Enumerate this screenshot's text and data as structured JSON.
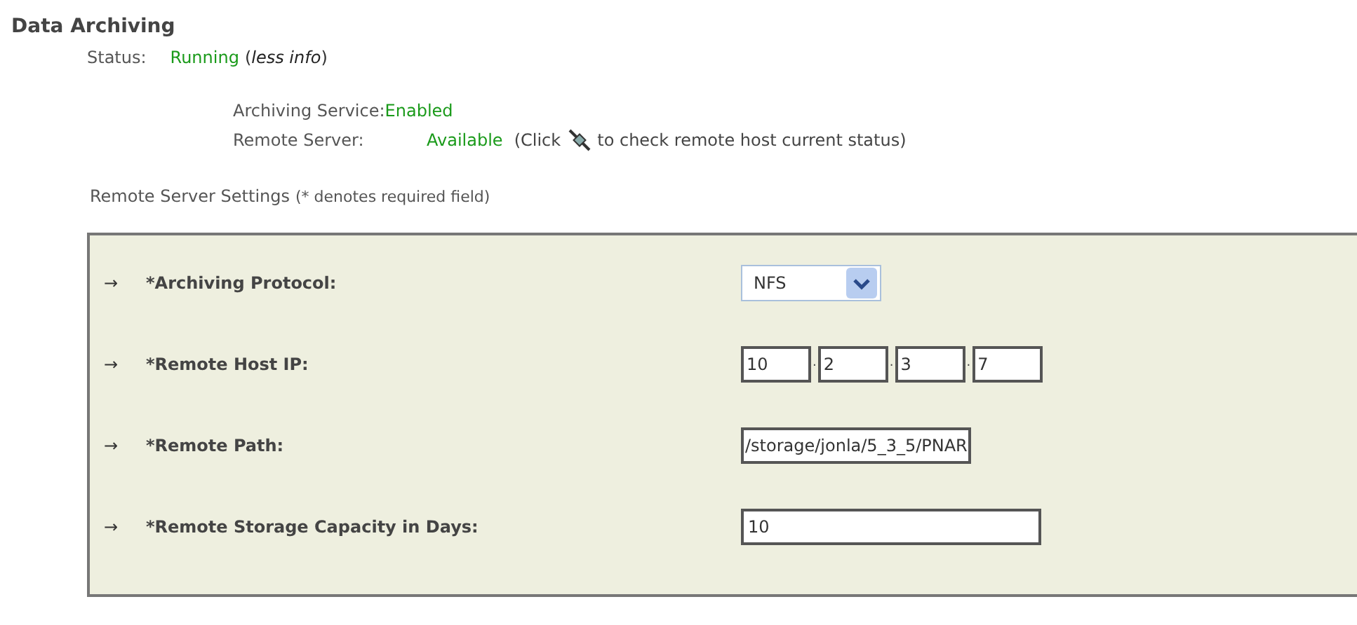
{
  "title": "Data Archiving",
  "status": {
    "label": "Status:",
    "value": "Running",
    "open_paren": "(",
    "link": "less info",
    "close_paren": ")"
  },
  "details": [
    {
      "label": "Archiving Service:",
      "value": "Enabled"
    },
    {
      "label": "Remote Server:",
      "value": "Available",
      "note_before": "(Click",
      "note_after": "to check remote host current status)"
    }
  ],
  "settings_heading": "Remote Server Settings",
  "settings_note": "(* denotes required field)",
  "fields": [
    {
      "kind": "select",
      "arrow": "→",
      "label": "*Archiving Protocol:",
      "value": "NFS"
    },
    {
      "kind": "ip",
      "arrow": "→",
      "label": "*Remote Host IP:",
      "parts": [
        "10",
        "2",
        "3",
        "7"
      ],
      "separator": "."
    },
    {
      "kind": "text",
      "arrow": "→",
      "label": "*Remote Path:",
      "value": "/storage/jonla/5_3_5/PNAR"
    },
    {
      "kind": "wide",
      "arrow": "→",
      "label": "*Remote Storage Capacity in Days:",
      "value": "10"
    }
  ]
}
